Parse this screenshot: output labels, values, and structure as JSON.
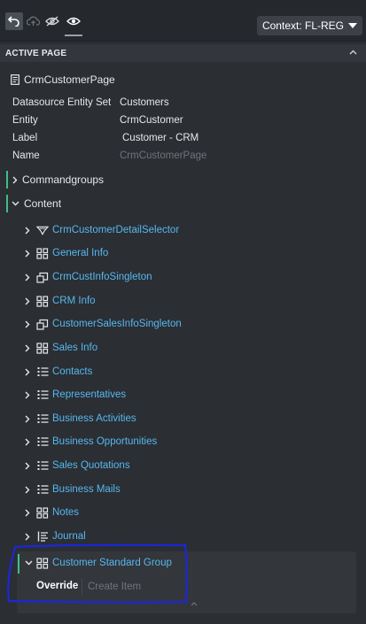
{
  "toolbar": {
    "undo_icon": "undo-icon",
    "cloud_icon": "cloud-upload-icon",
    "hide_icon": "eye-off-icon",
    "show_icon": "eye-icon",
    "context_label": "Context: FL-REG"
  },
  "section": {
    "title": "ACTIVE PAGE"
  },
  "page": {
    "title": "CrmCustomerPage",
    "properties": [
      {
        "key": "Datasource Entity Set",
        "value": "Customers"
      },
      {
        "key": "Entity",
        "value": "CrmCustomer"
      },
      {
        "key": "Label",
        "value": "Customer - CRM"
      },
      {
        "key": "Name",
        "value": "CrmCustomerPage"
      }
    ]
  },
  "groups": {
    "commandgroups": "Commandgroups",
    "content": "Content"
  },
  "content_items": [
    {
      "label": "CrmCustomerDetailSelector",
      "icon": "selector-icon"
    },
    {
      "label": "General Info",
      "icon": "group-icon"
    },
    {
      "label": "CrmCustInfoSingleton",
      "icon": "singleton-icon"
    },
    {
      "label": "CRM Info",
      "icon": "group-icon"
    },
    {
      "label": "CustomerSalesInfoSingleton",
      "icon": "singleton-icon"
    },
    {
      "label": "Sales Info",
      "icon": "group-icon"
    },
    {
      "label": "Contacts",
      "icon": "list-icon"
    },
    {
      "label": "Representatives",
      "icon": "list-icon"
    },
    {
      "label": "Business Activities",
      "icon": "list-icon"
    },
    {
      "label": "Business Opportunities",
      "icon": "list-icon"
    },
    {
      "label": "Sales Quotations",
      "icon": "list-icon"
    },
    {
      "label": "Business Mails",
      "icon": "list-icon"
    },
    {
      "label": "Notes",
      "icon": "group-icon"
    },
    {
      "label": "Journal",
      "icon": "timeline-icon"
    }
  ],
  "selected_item": {
    "label": "Customer Standard Group",
    "icon": "group-icon",
    "override_label": "Override",
    "create_item_label": "Create Item"
  },
  "colors": {
    "background": "#2b2e33",
    "link": "#56b8f0",
    "accent": "#3fbf86",
    "annotation": "#1c27d6"
  }
}
